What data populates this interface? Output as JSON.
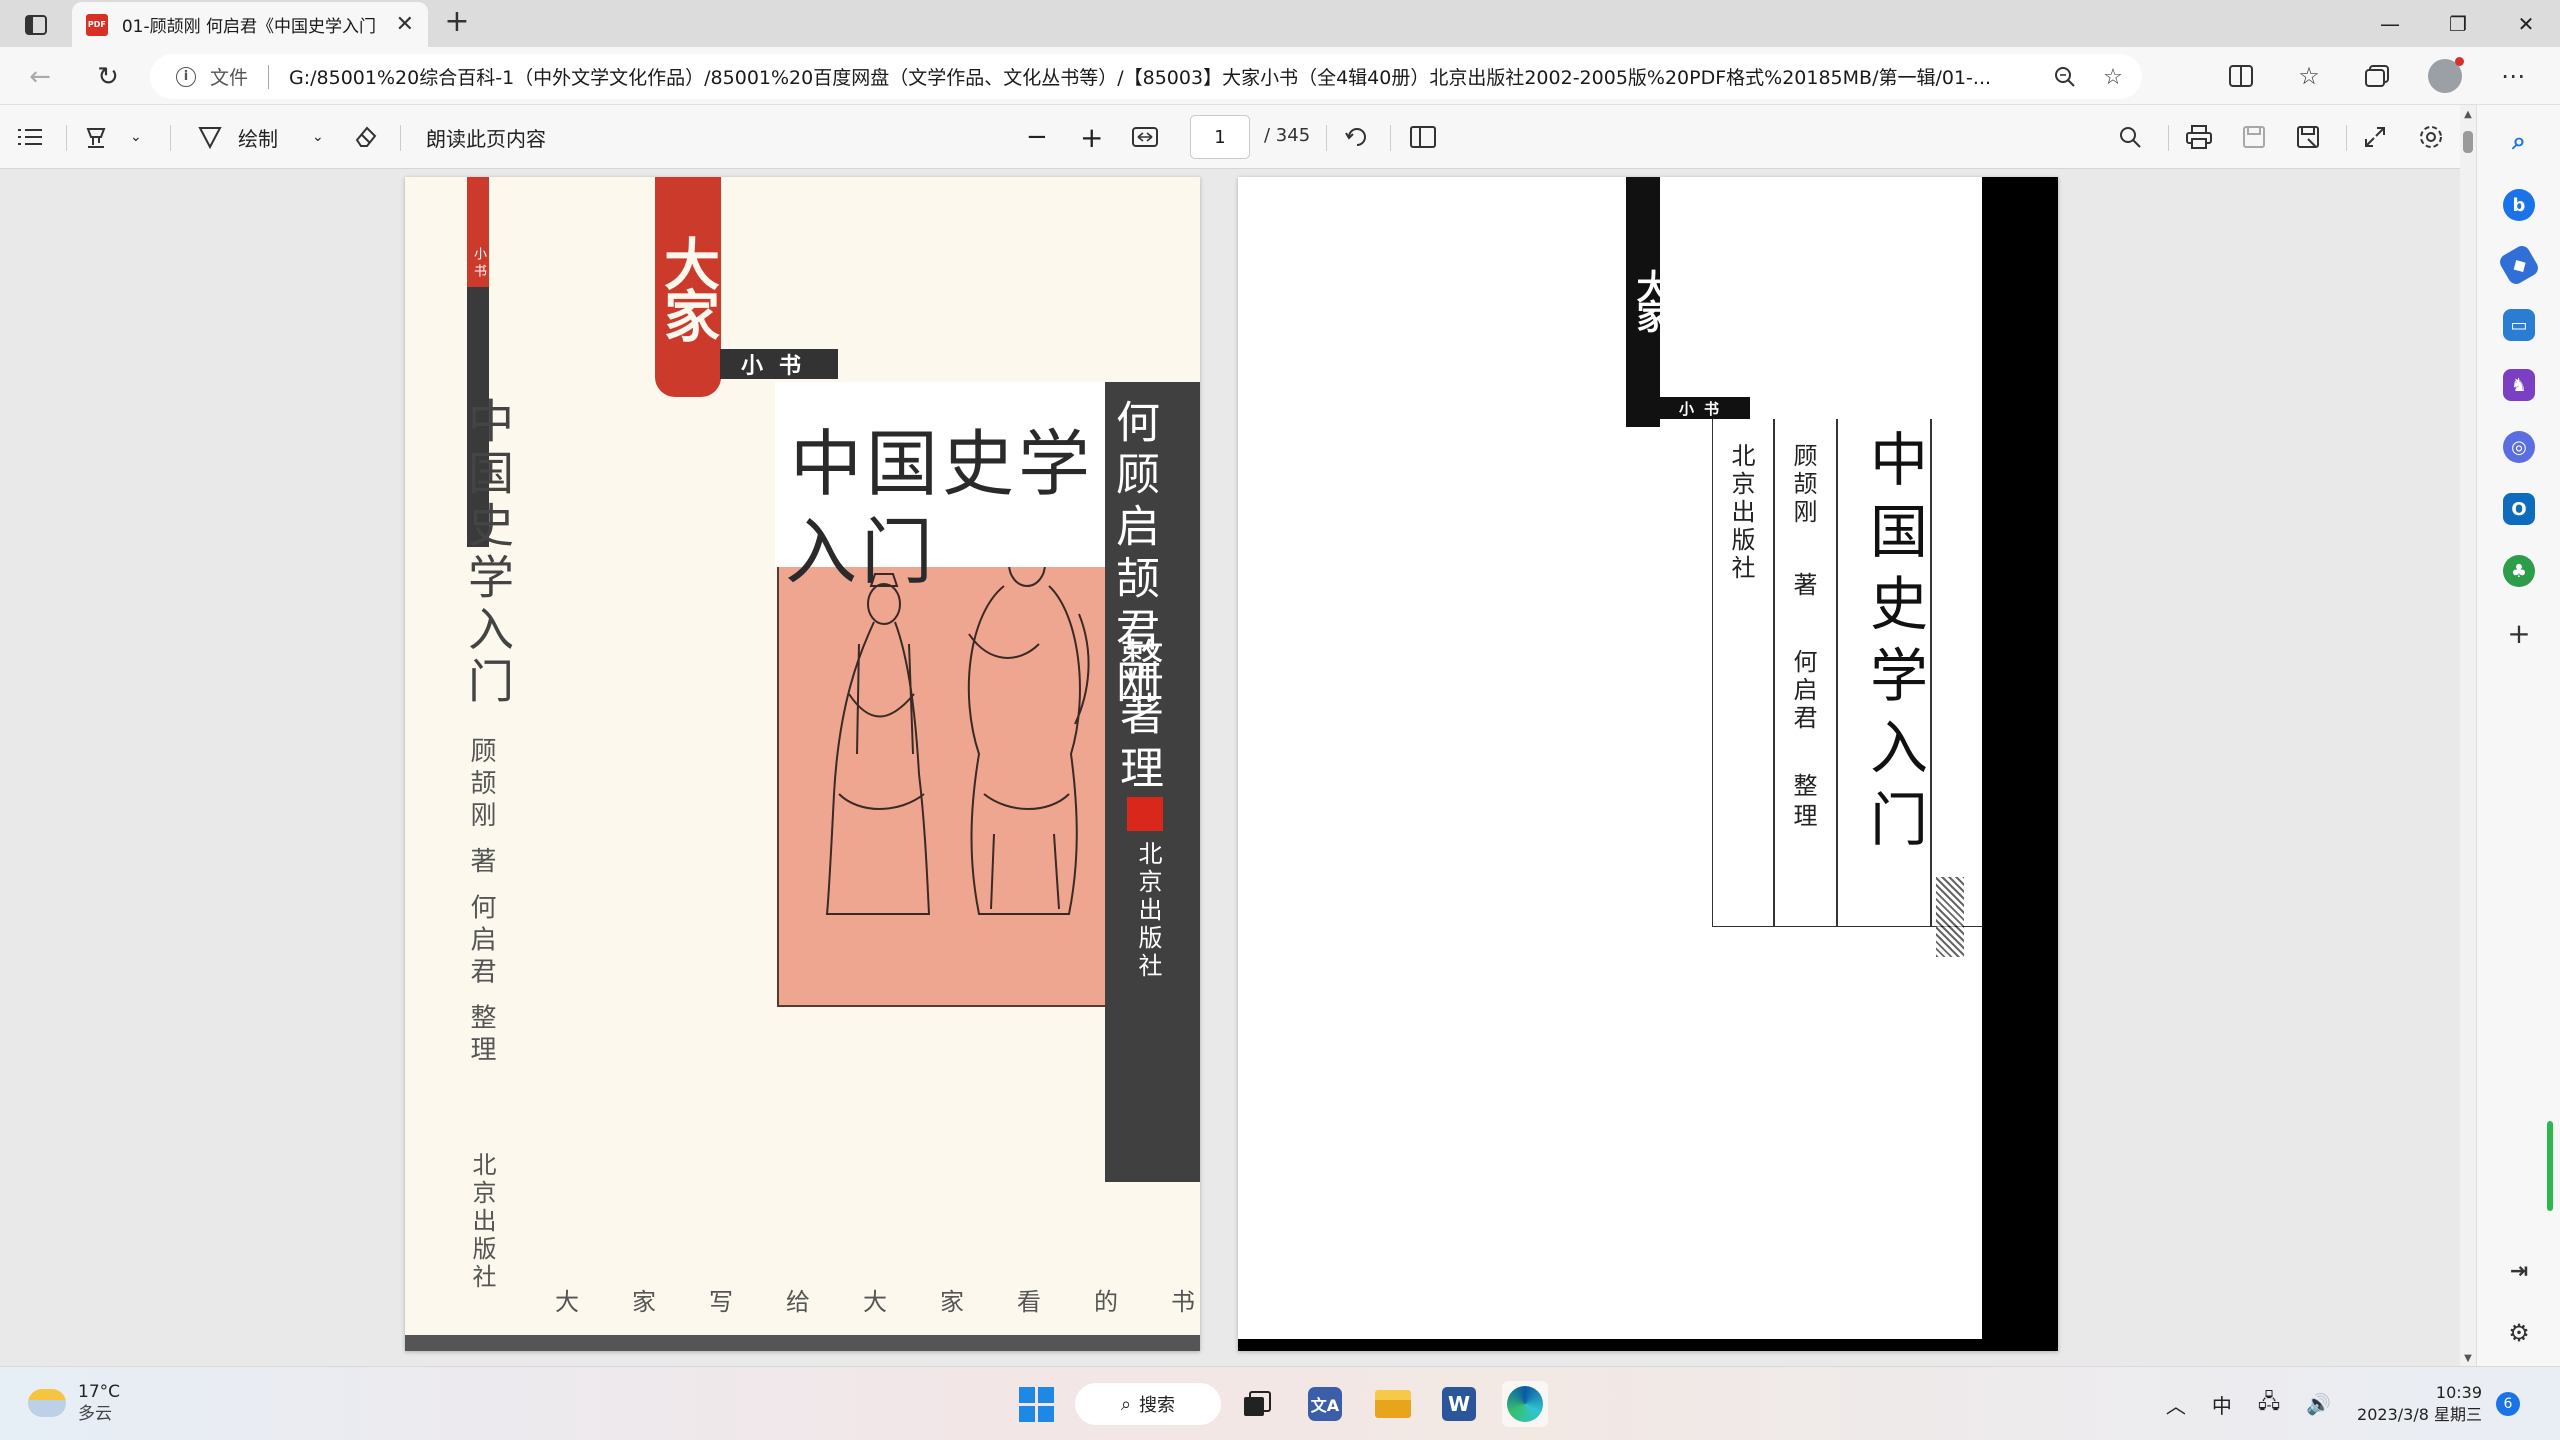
{
  "browser": {
    "tab_title": "01-顾颉刚 何启君《中国史学入门",
    "tab_favicon": "PDF",
    "address_scheme": "文件",
    "url": "G:/85001%20综合百科-1（中外文学文化作品）/85001%20百度网盘（文学作品、文化丛书等）/【85003】大家小书（全4辑40册）北京出版社2002-2005版%20PDF格式%20185MB/第一辑/01-..."
  },
  "pdf_toolbar": {
    "draw_label": "绘制",
    "read_aloud_label": "朗读此页内容",
    "current_page": "1",
    "total_pages": "/ 345"
  },
  "cover": {
    "spine_small": "小书",
    "spine_title": "中国史学入门",
    "spine_author": "顾颉刚 著 何启君 整理",
    "spine_publisher": "北京出版社",
    "seal_text": "大家",
    "series_label": "小书",
    "title_line1": "中国史学",
    "title_line2": "入门",
    "band_authors": "何顾启颉君刚",
    "band_verbs": "整著理",
    "band_publisher": "北京出版社",
    "slogan": [
      "大",
      "家",
      "写",
      "给",
      "大",
      "家",
      "看",
      "的",
      "书"
    ]
  },
  "title_page": {
    "seal_text": "大家",
    "series_label": "小书",
    "publisher": "北京出版社",
    "author": "顾颉刚",
    "verb1": "著",
    "editor": "何启君",
    "verb2": "整理",
    "title": "中国史学入门"
  },
  "taskbar": {
    "weather_temp": "17°C",
    "weather_cond": "多云",
    "search_label": "搜索",
    "ime": "中",
    "time": "10:39",
    "date": "2023/3/8 星期三",
    "notification_count": "6"
  },
  "colors": {
    "cover_red": "#cc3a2c",
    "cover_pink": "#efa691",
    "cover_band": "#404040",
    "accent_blue": "#1a73e8"
  }
}
